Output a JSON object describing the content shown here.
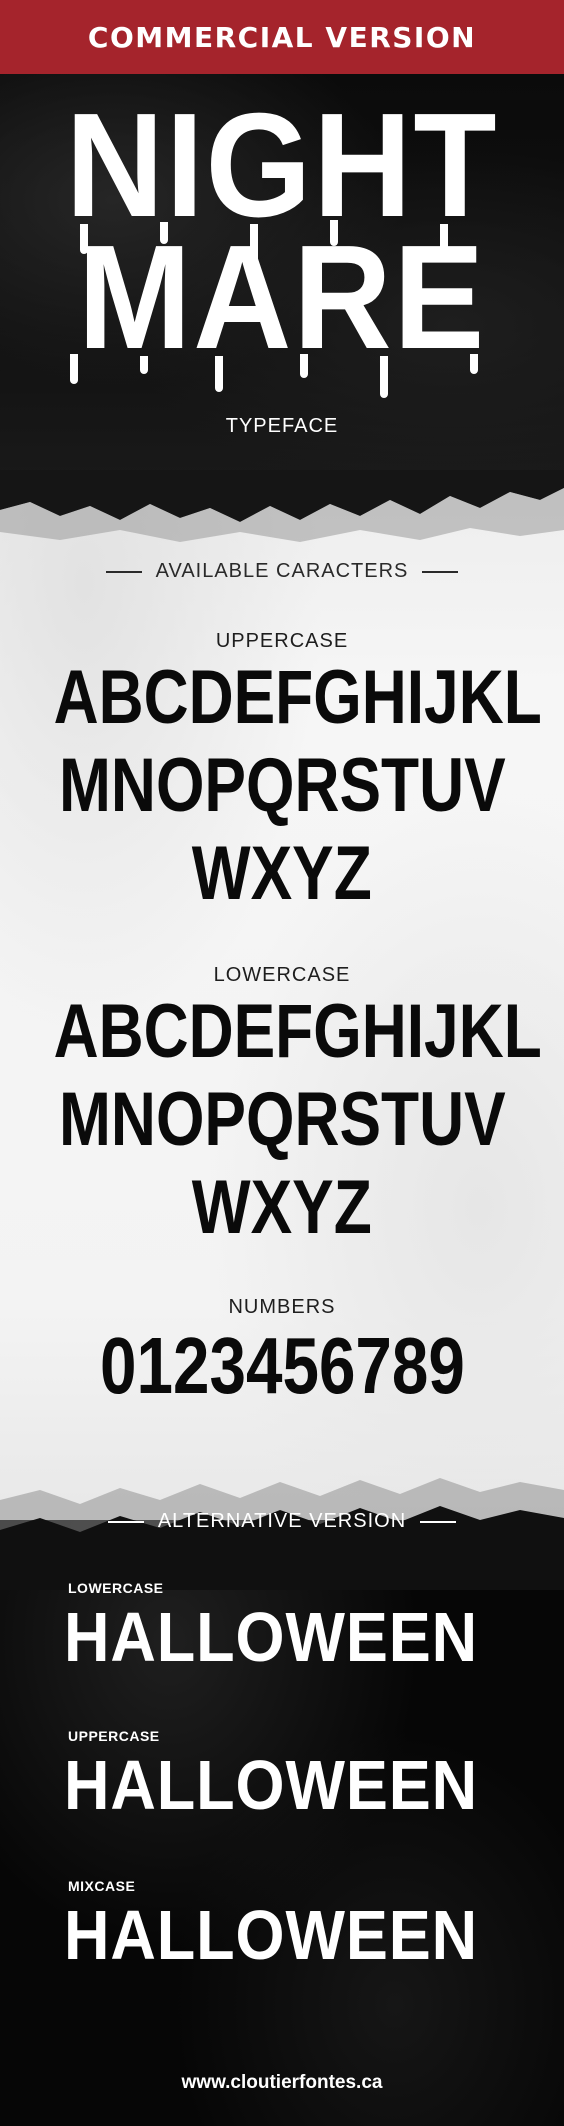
{
  "banner": {
    "text": "COMMERCIAL VERSION"
  },
  "hero": {
    "line1": "NIGHT",
    "line2": "MARE",
    "subtitle": "TYPEFACE"
  },
  "characters": {
    "heading": "AVAILABLE CARACTERS",
    "uppercase": {
      "label": "UPPERCASE",
      "rows": [
        "ABCDEFGHIJKL",
        "MNOPQRSTUV",
        "WXYZ"
      ]
    },
    "lowercase": {
      "label": "LOWERCASE",
      "rows": [
        "ABCDEFGHIJKL",
        "MNOPQRSTUV",
        "WXYZ"
      ]
    },
    "numbers": {
      "label": "NUMBERS",
      "row": "0123456789"
    }
  },
  "alternative": {
    "heading": "ALTERNATIVE VERSION",
    "samples": [
      {
        "label": "LOWERCASE",
        "word": "HALLOWEEN"
      },
      {
        "label": "UPPERCASE",
        "word": "HALLOWEEN"
      },
      {
        "label": "MIXCASE",
        "word": "HALLOWEEN"
      }
    ]
  },
  "footer": {
    "url": "www.cloutierfontes.ca"
  },
  "colors": {
    "banner": "#a5242c",
    "dark": "#050505",
    "light": "#f3f3f3",
    "ink": "#0a0a0a"
  }
}
